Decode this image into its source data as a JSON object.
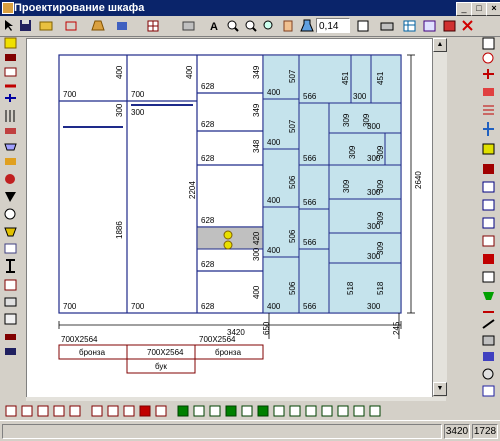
{
  "window": {
    "title": "Проектирование шкафа"
  },
  "toolbar": {
    "zoom_value": "0,14"
  },
  "status": {
    "width": "3420",
    "height": "1728"
  },
  "drawing": {
    "sec1": {
      "top_w": "700",
      "top_h": "400",
      "shelf_h": "300",
      "tall_h": "1886",
      "bottom_w": "700"
    },
    "sec2": {
      "top_w": "700",
      "top_h": "400",
      "shelf_h": "300",
      "bottom_w": "700",
      "total_h": "2204"
    },
    "sec3": {
      "w": "628",
      "h1": "349",
      "h2": "349",
      "h3": "348",
      "h4": "420",
      "h5": "300",
      "h6": "400"
    },
    "sec4": {
      "w": "400",
      "h1": "507",
      "h2": "507",
      "h3": "506",
      "h4": "506",
      "h5": "506"
    },
    "panels": {
      "w566": "566",
      "w300": "300",
      "w309": "309",
      "w518": "518",
      "h451": "451",
      "h309": "309",
      "h518": "518"
    },
    "total_width": "3420",
    "total_height": "2640",
    "side_depth": "650",
    "base_h": "245",
    "doors": {
      "d1_size": "700X2564",
      "d1_mat": "бронза",
      "d2_size": "700X2564",
      "d2_mat": "бук",
      "d3_size": "700X2564",
      "d3_mat": "бронза",
      "mid_label": "700X2564"
    }
  },
  "colors": {
    "titlebar": "#0a246a",
    "panel_fill": "#c5e3ec",
    "drawing_line": "#1e2a8a",
    "highlight": "#e8e000"
  }
}
